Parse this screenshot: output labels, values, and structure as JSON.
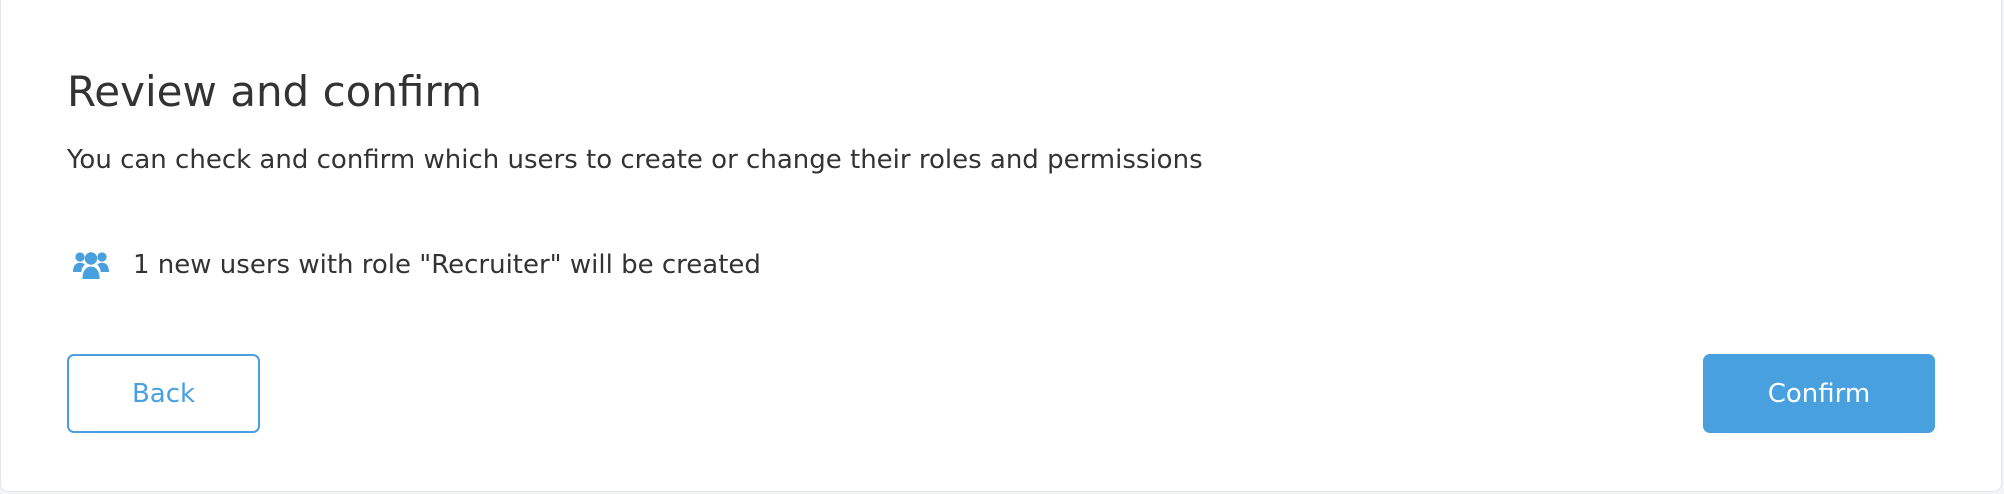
{
  "dialog": {
    "title": "Review and confirm",
    "subtitle": "You can check and confirm which users to create or change their roles and permissions",
    "summary": {
      "icon": "users-icon",
      "text": "1 new users with role \"Recruiter\" will be created"
    },
    "actions": {
      "back_label": "Back",
      "confirm_label": "Confirm"
    }
  },
  "colors": {
    "accent": "#48a0df",
    "text": "#333333",
    "background": "#ffffff"
  }
}
